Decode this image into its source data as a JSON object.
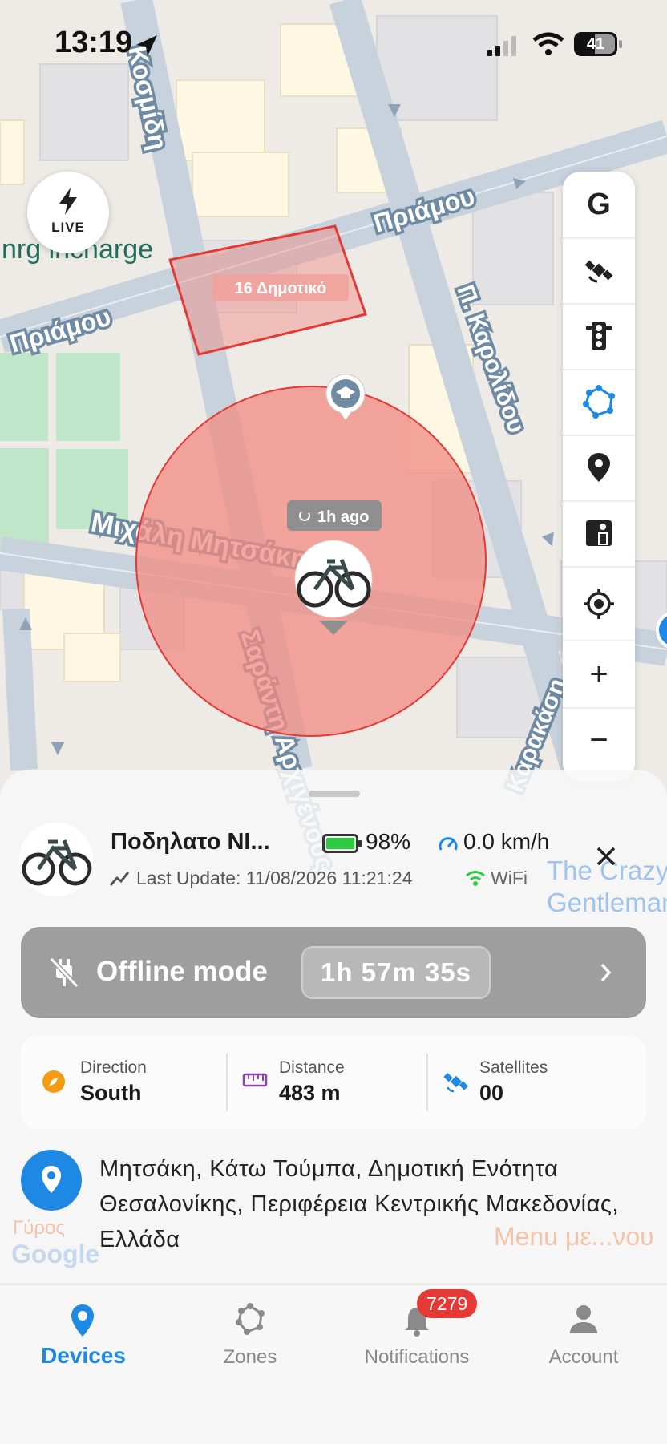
{
  "status_bar": {
    "time": "13:19",
    "battery": "41"
  },
  "map": {
    "streets": [
      "Πριάμου",
      "Πριάμου",
      "Μιχάλη Μητσάκη",
      "Σαράντη Αρχιγένους",
      "Π. Καρολίδου",
      "Κοσμίδη",
      "Καρακάση"
    ],
    "brand_label": "nrg incharge",
    "zone_label": "16 Δημοτικό",
    "device_bubble": "1h ago",
    "poi_labels": [
      "The Crazy Gentleman",
      "Menu με...νου",
      "Γύρος"
    ],
    "watermark": "Google",
    "live_button": "LIVE"
  },
  "toolbar": {
    "google_label": "G",
    "zoom_in": "+",
    "zoom_out": "−"
  },
  "device": {
    "name": "Ποδηλατο ΝΙ...",
    "battery": "98%",
    "battery_level": 0.98,
    "speed": "0.0 km/h",
    "last_update": "Last Update: 11/08/2026 11:21:24",
    "connection": "WiFi"
  },
  "offline": {
    "label": "Offline mode",
    "timer": "1h 57m 35s"
  },
  "stats": [
    {
      "key": "Direction",
      "value": "South"
    },
    {
      "key": "Distance",
      "value": "483 m"
    },
    {
      "key": "Satellites",
      "value": "00"
    }
  ],
  "address": "Μητσάκη, Κάτω Τούμπα, Δημοτική Ενότητα Θεσαλονίκης, Περιφέρεια Κεντρικής Μακεδονίας, Ελλάδα",
  "nav": {
    "items": [
      {
        "label": "Devices"
      },
      {
        "label": "Zones"
      },
      {
        "label": "Notifications"
      },
      {
        "label": "Account"
      }
    ],
    "badge": "7279"
  },
  "colors": {
    "accent": "#1e88e5",
    "zone_fill": "#f28b82",
    "offline_bg": "#9e9e9e",
    "badge": "#e53935",
    "battery": "#2ecc40"
  }
}
